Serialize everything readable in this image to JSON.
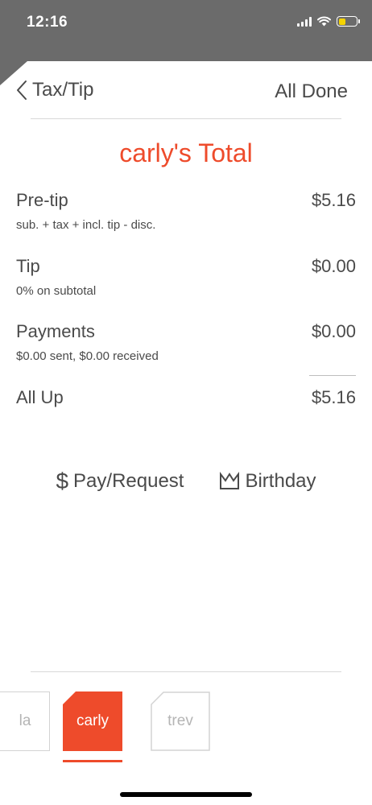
{
  "status_bar": {
    "time": "12:16",
    "battery_color": "#f5d300"
  },
  "header": {
    "back_label": "Tax/Tip",
    "done_label": "All Done"
  },
  "title": "carly's Total",
  "rows": [
    {
      "label": "Pre-tip",
      "sub": "sub. + tax + incl. tip - disc.",
      "value": "$5.16"
    },
    {
      "label": "Tip",
      "sub": "0% on subtotal",
      "value": "$0.00"
    },
    {
      "label": "Payments",
      "sub": "$0.00 sent, $0.00 received",
      "value": "$0.00"
    }
  ],
  "total": {
    "label": "All Up",
    "value": "$5.16"
  },
  "actions": {
    "pay": {
      "icon": "dollar-icon",
      "glyph": "$",
      "label": "Pay/Request"
    },
    "birthday": {
      "icon": "crown-icon",
      "label": "Birthday"
    }
  },
  "tabs": [
    {
      "label": "la",
      "state": "partial"
    },
    {
      "label": "carly",
      "state": "active"
    },
    {
      "label": "trev",
      "state": "inactive"
    }
  ],
  "colors": {
    "accent": "#ee4b2b",
    "text": "#4a4a4a",
    "status_bar": "#6b6b6b"
  }
}
